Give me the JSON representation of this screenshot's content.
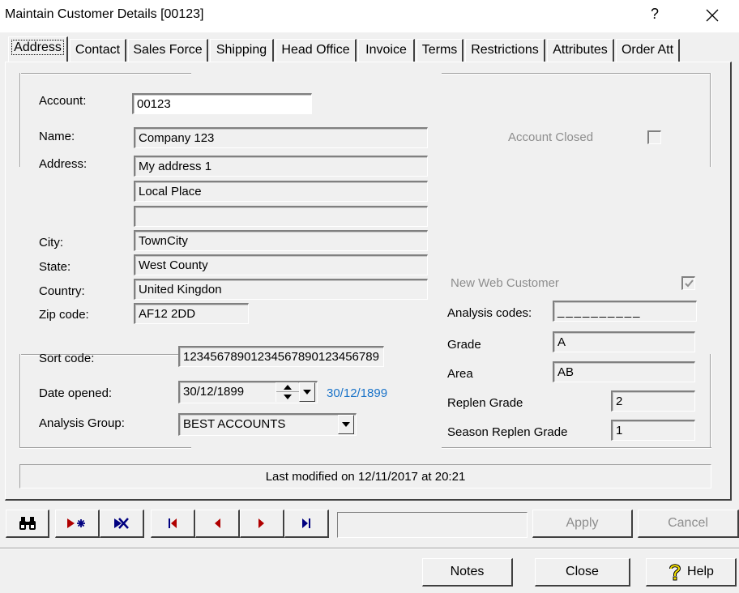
{
  "window": {
    "title": "Maintain Customer Details [00123]",
    "help_glyph": "?"
  },
  "tabs": [
    {
      "label": "Address",
      "active": true
    },
    {
      "label": "Contact"
    },
    {
      "label": "Sales Force"
    },
    {
      "label": "Shipping"
    },
    {
      "label": "Head Office"
    },
    {
      "label": "Invoice"
    },
    {
      "label": "Terms"
    },
    {
      "label": "Restrictions"
    },
    {
      "label": "Attributes"
    },
    {
      "label": "Order Att"
    }
  ],
  "address": {
    "account_label": "Account:",
    "account_value": "00123",
    "name_label": "Name:",
    "name_value": "Company 123",
    "address_label": "Address:",
    "address_lines": [
      "My address 1",
      "Local Place",
      ""
    ],
    "city_label": "City:",
    "city_value": "TownCity",
    "state_label": "State:",
    "state_value": "West County",
    "country_label": "Country:",
    "country_value": "United Kingdon",
    "zip_label": "Zip code:",
    "zip_value": "AF12 2DD",
    "account_closed_label": "Account Closed",
    "account_closed_checked": false
  },
  "other": {
    "sort_code_label": "Sort code:",
    "sort_code_value": "12345678901234567890123456789",
    "date_opened_label": "Date opened:",
    "date_opened_value": "30/12/1899",
    "date_opened_display": "30/12/1899",
    "analysis_group_label": "Analysis Group:",
    "analysis_group_value": "BEST ACCOUNTS",
    "new_web_customer_label": "New Web Customer",
    "new_web_customer_checked": true,
    "analysis_codes_label": "Analysis codes:",
    "analysis_codes_value": "__________",
    "grade_label": "Grade",
    "grade_value": "A",
    "area_label": "Area",
    "area_value": "AB",
    "replen_grade_label": "Replen Grade",
    "replen_grade_value": "2",
    "season_replen_grade_label": "Season Replen Grade",
    "season_replen_grade_value": "1"
  },
  "status": {
    "last_modified": "Last modified on 12/11/2017 at 20:21"
  },
  "toolbar": {
    "record_value": "",
    "apply_label": "Apply",
    "cancel_label": "Cancel"
  },
  "footer": {
    "notes_label": "Notes",
    "close_label": "Close",
    "help_label": "Help"
  },
  "colors": {
    "date_link": "#1a73c8",
    "icon_red": "#b00000",
    "icon_navy": "#000080",
    "disabled_text": "#8d8d8d"
  }
}
